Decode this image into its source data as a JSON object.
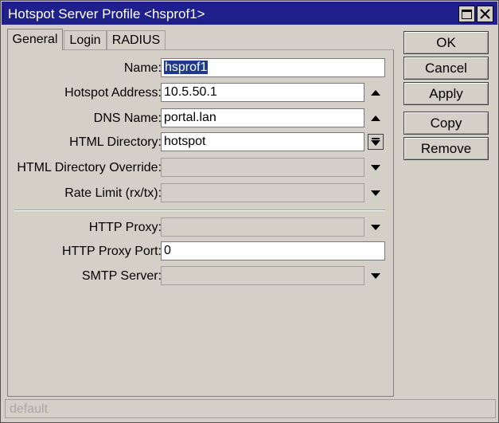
{
  "window": {
    "title": "Hotspot Server Profile <hsprof1>",
    "title_bar_color": "#20208c"
  },
  "tabs": [
    {
      "label": "General",
      "active": true
    },
    {
      "label": "Login",
      "active": false
    },
    {
      "label": "RADIUS",
      "active": false
    }
  ],
  "fields": {
    "name": {
      "label": "Name:",
      "value": "hsprof1"
    },
    "hotspot_address": {
      "label": "Hotspot Address:",
      "value": "10.5.50.1"
    },
    "dns_name": {
      "label": "DNS Name:",
      "value": "portal.lan"
    },
    "html_directory": {
      "label": "HTML Directory:",
      "value": "hotspot"
    },
    "html_directory_override": {
      "label": "HTML Directory Override:",
      "value": ""
    },
    "rate_limit": {
      "label": "Rate Limit (rx/tx):",
      "value": ""
    },
    "http_proxy": {
      "label": "HTTP Proxy:",
      "value": ""
    },
    "http_proxy_port": {
      "label": "HTTP Proxy Port:",
      "value": "0"
    },
    "smtp_server": {
      "label": "SMTP Server:",
      "value": ""
    }
  },
  "buttons": {
    "ok": "OK",
    "cancel": "Cancel",
    "apply": "Apply",
    "copy": "Copy",
    "remove": "Remove"
  },
  "status": {
    "text": "default"
  },
  "icons": {
    "maximize": "maximize-icon",
    "close": "close-icon",
    "collapse": "triangle-up-icon",
    "dropdown": "triangle-down-icon",
    "select": "download-arrow-icon"
  }
}
